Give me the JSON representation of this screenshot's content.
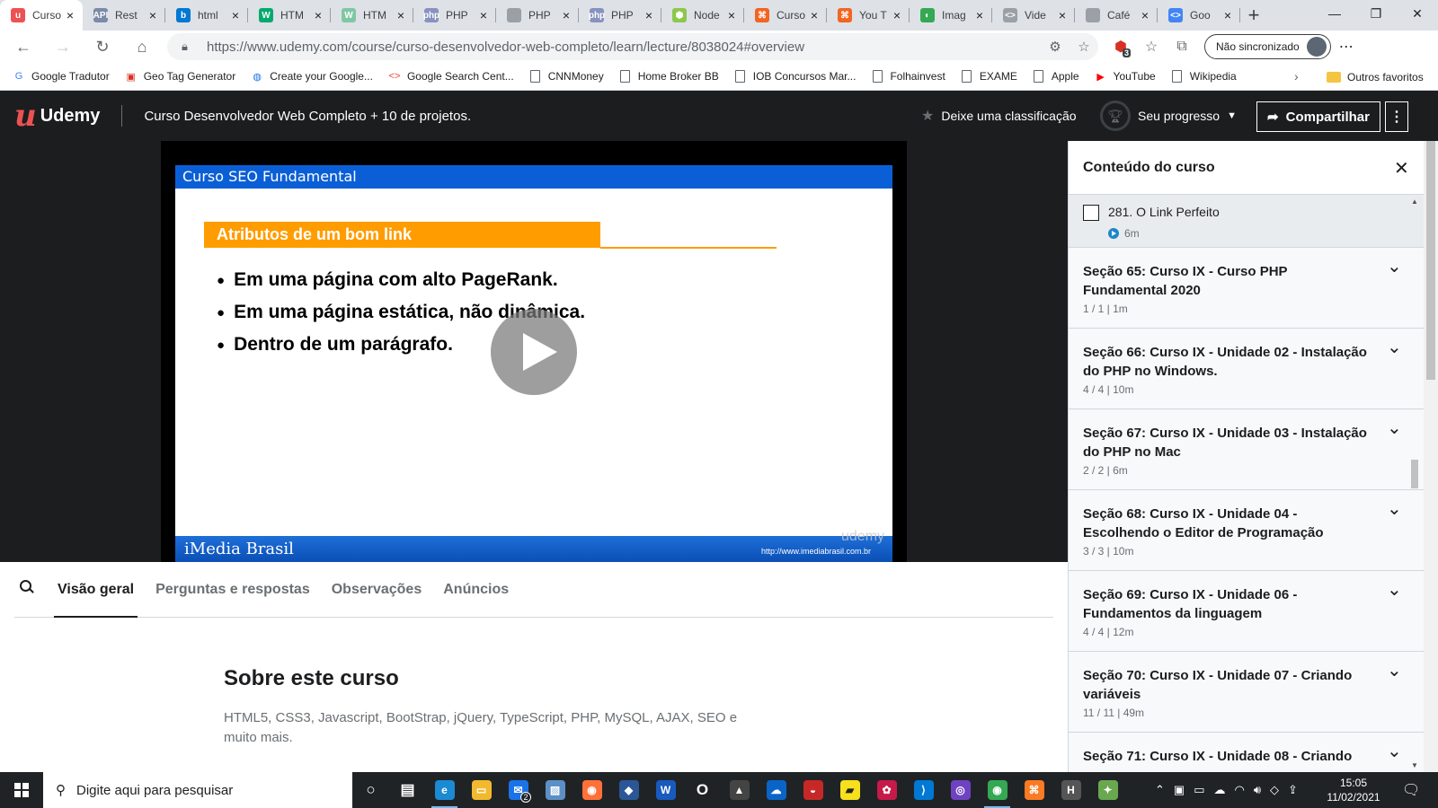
{
  "browser": {
    "tabs": [
      {
        "title": "Curso",
        "icon": "udemy-icon",
        "color": "#ec5252",
        "glyph": "u",
        "active": true
      },
      {
        "title": "Rest",
        "icon": "api-icon",
        "color": "#7a8ba8",
        "glyph": "API"
      },
      {
        "title": "html",
        "icon": "bing-icon",
        "color": "#0078d4",
        "glyph": "b"
      },
      {
        "title": "HTM",
        "icon": "w3schools-icon",
        "color": "#04aa6d",
        "glyph": "W"
      },
      {
        "title": "HTM",
        "icon": "w3schools-icon",
        "color": "#7fc7a3",
        "glyph": "W"
      },
      {
        "title": "PHP",
        "icon": "php-icon",
        "color": "#8892bf",
        "glyph": "php"
      },
      {
        "title": "PHP",
        "icon": "document-icon",
        "color": "#9aa0a6",
        "glyph": ""
      },
      {
        "title": "PHP",
        "icon": "php-icon",
        "color": "#8892bf",
        "glyph": "php"
      },
      {
        "title": "Node",
        "icon": "node-icon",
        "color": "#8cc84b",
        "glyph": "⬢"
      },
      {
        "title": "Curso",
        "icon": "udemy-icon",
        "color": "#f26522",
        "glyph": "⌘"
      },
      {
        "title": "You T",
        "icon": "udemy-icon",
        "color": "#f26522",
        "glyph": "⌘"
      },
      {
        "title": "Imag",
        "icon": "image-icon",
        "color": "#34a853",
        "glyph": "◐"
      },
      {
        "title": "Vide",
        "icon": "code-icon",
        "color": "#9aa0a6",
        "glyph": "<>"
      },
      {
        "title": "Café",
        "icon": "document-icon",
        "color": "#9aa0a6",
        "glyph": ""
      },
      {
        "title": "Goo",
        "icon": "google-icon",
        "color": "#4285f4",
        "glyph": "<>"
      }
    ],
    "url": "https://www.udemy.com/course/curso-desenvolvedor-web-completo/learn/lecture/8038024#overview",
    "sync_label": "Não sincronizado",
    "ext_badge": "3",
    "bookmarks": [
      {
        "label": "Google Tradutor",
        "icon": "translate-icon",
        "color": "#4285f4",
        "glyph": "G"
      },
      {
        "label": "Geo Tag Generator",
        "icon": "geotag-icon",
        "color": "#d93025",
        "glyph": "▣"
      },
      {
        "label": "Create your Google...",
        "icon": "globe-icon",
        "color": "#1a73e8",
        "glyph": "◍"
      },
      {
        "label": "Google Search Cent...",
        "icon": "search-console-icon",
        "color": "#ea4335",
        "glyph": "<>"
      },
      {
        "label": "CNNMoney",
        "icon": "document-icon",
        "color": "",
        "glyph": ""
      },
      {
        "label": "Home Broker BB",
        "icon": "document-icon",
        "color": "",
        "glyph": ""
      },
      {
        "label": "IOB Concursos Mar...",
        "icon": "document-icon",
        "color": "",
        "glyph": ""
      },
      {
        "label": "Folhainvest",
        "icon": "document-icon",
        "color": "",
        "glyph": ""
      },
      {
        "label": "EXAME",
        "icon": "document-icon",
        "color": "",
        "glyph": ""
      },
      {
        "label": "Apple",
        "icon": "document-icon",
        "color": "",
        "glyph": ""
      },
      {
        "label": "YouTube",
        "icon": "youtube-icon",
        "color": "#ff0000",
        "glyph": "▶"
      },
      {
        "label": "Wikipedia",
        "icon": "document-icon",
        "color": "",
        "glyph": ""
      }
    ],
    "other_bookmarks": "Outros favoritos"
  },
  "header": {
    "logo": "Udemy",
    "course_title": "Curso Desenvolvedor Web Completo + 10 de projetos.",
    "rate_label": "Deixe uma classificação",
    "progress_label": "Seu progresso",
    "share_label": "Compartilhar"
  },
  "slide": {
    "top_title": "Curso SEO Fundamental",
    "heading": "Atributos de um bom link",
    "bullets": [
      "Em uma página com alto PageRank.",
      "Em uma página estática, não dinâmica.",
      "Dentro de um parágrafo."
    ],
    "footer_brand": "iMedia Brasil",
    "footer_site": "http://www.imediabrasil.com.br",
    "watermark": "udemy"
  },
  "content_tabs": [
    {
      "label": "Visão geral",
      "active": true
    },
    {
      "label": "Perguntas e respostas"
    },
    {
      "label": "Observações"
    },
    {
      "label": "Anúncios"
    }
  ],
  "about": {
    "title": "Sobre este curso",
    "text": "HTML5, CSS3, Javascript, BootStrap, jQuery, TypeScript, PHP, MySQL, AJAX, SEO e muito mais."
  },
  "sidebar": {
    "title": "Conteúdo do curso",
    "current_lecture": {
      "name": "281. O Link Perfeito",
      "duration": "6m"
    },
    "sections": [
      {
        "title": "Seção 65: Curso IX - Curso PHP Fundamental 2020",
        "meta": "1 / 1 | 1m"
      },
      {
        "title": "Seção 66: Curso IX - Unidade 02 - Instalação do PHP no Windows.",
        "meta": "4 / 4 | 10m"
      },
      {
        "title": "Seção 67: Curso IX - Unidade 03 - Instalação do PHP no Mac",
        "meta": "2 / 2 | 6m"
      },
      {
        "title": "Seção 68: Curso IX - Unidade 04 - Escolhendo o Editor de Programação",
        "meta": "3 / 3 | 10m"
      },
      {
        "title": "Seção 69: Curso IX - Unidade 06 - Fundamentos da linguagem",
        "meta": "4 / 4 | 12m"
      },
      {
        "title": "Seção 70: Curso IX - Unidade 07 - Criando variáveis",
        "meta": "11 / 11 | 49m"
      },
      {
        "title": "Seção 71: Curso IX - Unidade 08 - Criando",
        "meta": ""
      }
    ]
  },
  "taskbar": {
    "search_placeholder": "Digite aqui para pesquisar",
    "mail_badge": "2",
    "time": "15:05",
    "date": "11/02/2021",
    "notification_count": "3",
    "apps": [
      {
        "name": "task-view-icon",
        "glyph": "○",
        "color": ""
      },
      {
        "name": "widgets-icon",
        "glyph": "▤",
        "color": ""
      },
      {
        "name": "edge-icon",
        "glyph": "e",
        "color": "#1b8ad3",
        "open": true
      },
      {
        "name": "file-explorer-icon",
        "glyph": "▭",
        "color": "#f3b92e"
      },
      {
        "name": "mail-icon",
        "glyph": "✉",
        "color": "#1a73e8"
      },
      {
        "name": "photos-icon",
        "glyph": "▨",
        "color": "#5d8fc7"
      },
      {
        "name": "firefox-icon",
        "glyph": "◉",
        "color": "#ff7139"
      },
      {
        "name": "app-icon",
        "glyph": "◆",
        "color": "#2b5797"
      },
      {
        "name": "word-icon",
        "glyph": "W",
        "color": "#185abd"
      },
      {
        "name": "opera-icon",
        "glyph": "O",
        "color": ""
      },
      {
        "name": "game-icon",
        "glyph": "▲",
        "color": "#444"
      },
      {
        "name": "onedrive-icon",
        "glyph": "☁",
        "color": "#0a64c8"
      },
      {
        "name": "antivirus-icon",
        "glyph": "◒",
        "color": "#c62828"
      },
      {
        "name": "sticky-notes-icon",
        "glyph": "▰",
        "color": "#f7e01c"
      },
      {
        "name": "raspberry-icon",
        "glyph": "✿",
        "color": "#c51a4a"
      },
      {
        "name": "vscode-icon",
        "glyph": "⟩",
        "color": "#0078d4"
      },
      {
        "name": "app-purple-icon",
        "glyph": "◎",
        "color": "#6f42c1"
      },
      {
        "name": "chrome-icon",
        "glyph": "◉",
        "color": "#34a853",
        "open": true
      },
      {
        "name": "xampp-icon",
        "glyph": "⌘",
        "color": "#fb7a24"
      },
      {
        "name": "h-app-icon",
        "glyph": "H",
        "color": "#555"
      },
      {
        "name": "app-misc-icon",
        "glyph": "✦",
        "color": "#6aa84f"
      }
    ]
  }
}
